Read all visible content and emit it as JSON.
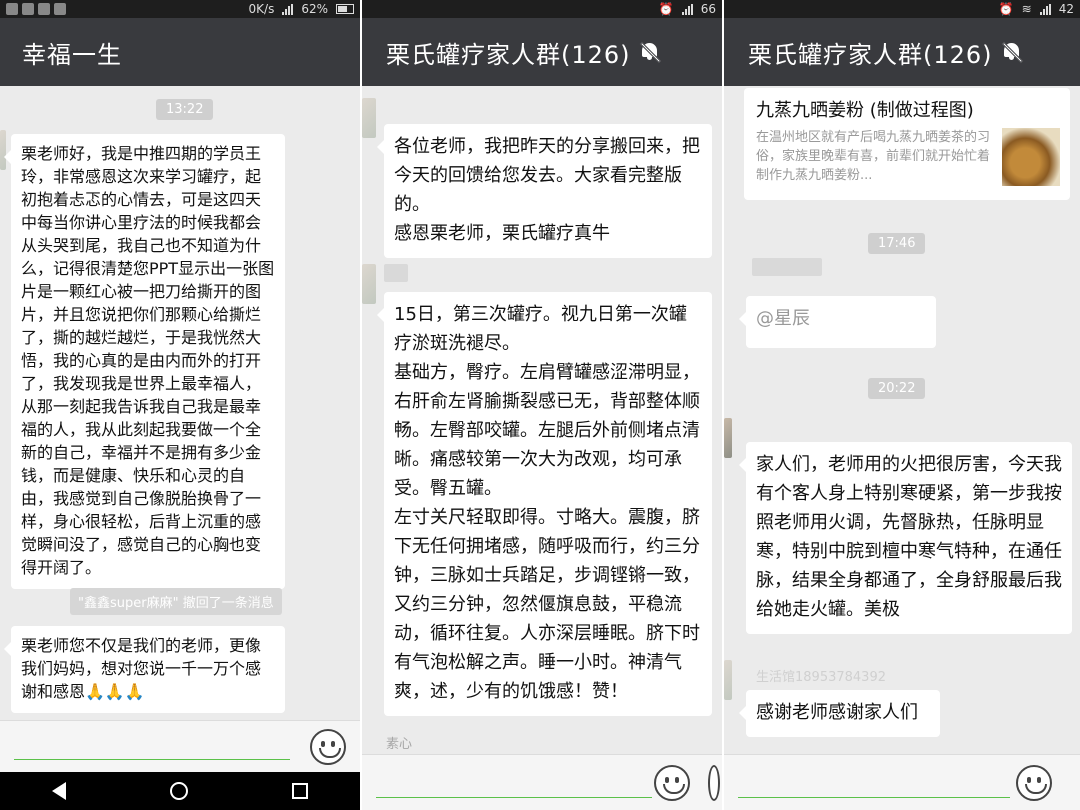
{
  "panel1": {
    "status": {
      "speed": "0K/s",
      "battery": "62%"
    },
    "title": "幸福一生",
    "time": "13:22",
    "message1": "栗老师好，我是中推四期的学员王玲，非常感恩这次来学习罐疗，起初抱着忐忑的心情去，可是这四天中每当你讲心里疗法的时候我都会从头哭到尾，我自己也不知道为什么，记得很清楚您PPT显示出一张图片是一颗红心被一把刀给撕开的图片，并且您说把你们那颗心给撕烂了，撕的越烂越烂，于是我恍然大悟，我的心真的是由内而外的打开了，我发现我是世界上最幸福人，从那一刻起我告诉我自己我是最幸福的人，我从此刻起我要做一个全新的自己，幸福并不是拥有多少金钱，而是健康、快乐和心灵的自由，我感觉到自己像脱胎换骨了一样，身心很轻松，后背上沉重的感觉瞬间没了，感觉自己的心胸也变得开阔了。",
    "recall_notice": "\"鑫鑫super麻麻\" 撤回了一条消息",
    "message2": "栗老师您不仅是我们的老师，更像我们妈妈，想对您说一千一万个感谢和感恩🙏🙏🙏"
  },
  "panel2": {
    "status": {
      "battery": "66"
    },
    "title": "栗氏罐疗家人群(126)",
    "message1": "各位老师，我把昨天的分享搬回来，把今天的回馈给您发去。大家看完整版的。\n感恩栗老师，栗氏罐疗真牛",
    "message2": "15日，第三次罐疗。视九日第一次罐疗淤斑洗褪尽。\n基础方，臀疗。左肩臂罐感涩滞明显，右肝俞左肾腧撕裂感已无，背部整体顺畅。左臀部咬罐。左腿后外前侧堵点清晰。痛感较第一次大为改观，均可承受。臀五罐。\n左寸关尺轻取即得。寸略大。震腹，脐下无任何拥堵感，随呼吸而行，约三分钟，三脉如士兵踏足，步调铿锵一致，又约三分钟，忽然偃旗息鼓，平稳流动，循环往复。人亦深层睡眠。脐下时有气泡松解之声。睡一小时。神清气爽，述，少有的饥饿感！赞！",
    "sender_bottom": "素心"
  },
  "panel3": {
    "status": {
      "battery": "42"
    },
    "title": "栗氏罐疗家人群(126)",
    "link_title": "九蒸九晒姜粉 (制做过程图)",
    "link_desc": "在温州地区就有产后喝九蒸九晒姜茶的习俗，家族里晚辈有喜，前辈们就开始忙着制作九蒸九晒姜粉...",
    "time1": "17:46",
    "mention": "@星辰",
    "time2": "20:22",
    "message1": "家人们，老师用的火把很厉害，今天我有个客人身上特别寒硬紧，第一步我按照老师用火调，先督脉热，任脉明显寒，特别中脘到檀中寒气特种，在通任脉，结果全身都通了，全身舒服最后我给她走火罐。美极",
    "sender_blurred": "生活馆18953784392",
    "message2": "感谢老师感谢家人们"
  }
}
